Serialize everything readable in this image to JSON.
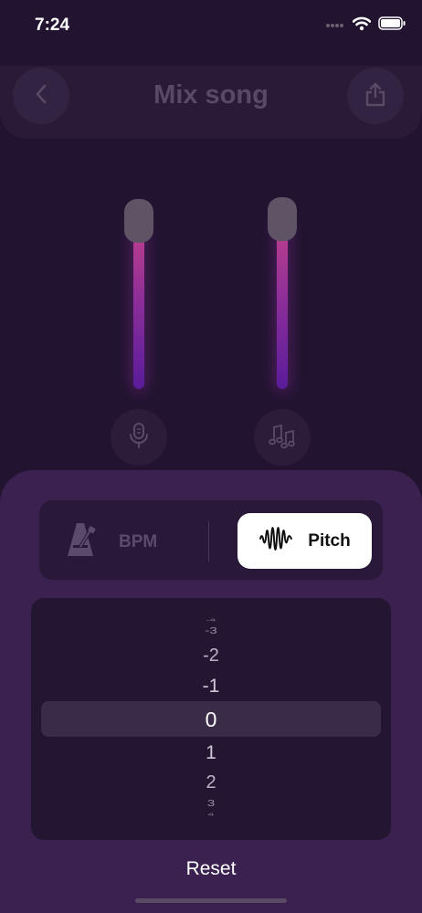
{
  "status_bar": {
    "time": "7:24"
  },
  "header": {
    "title": "Mix song"
  },
  "sliders": [
    {
      "name": "vocal",
      "level": 0.95
    },
    {
      "name": "music",
      "level": 0.95
    }
  ],
  "segmented": {
    "bpm_label": "BPM",
    "pitch_label": "Pitch",
    "selected": "Pitch"
  },
  "picker": {
    "values": [
      "-4",
      "-3",
      "-2",
      "-1",
      "0",
      "1",
      "2",
      "3",
      "4"
    ],
    "selected": "0"
  },
  "footer": {
    "reset_label": "Reset"
  },
  "icons": [
    "chevron-left-icon",
    "share-icon",
    "microphone-icon",
    "music-notes-icon",
    "metronome-icon",
    "waveform-icon",
    "wifi-icon",
    "battery-icon"
  ]
}
